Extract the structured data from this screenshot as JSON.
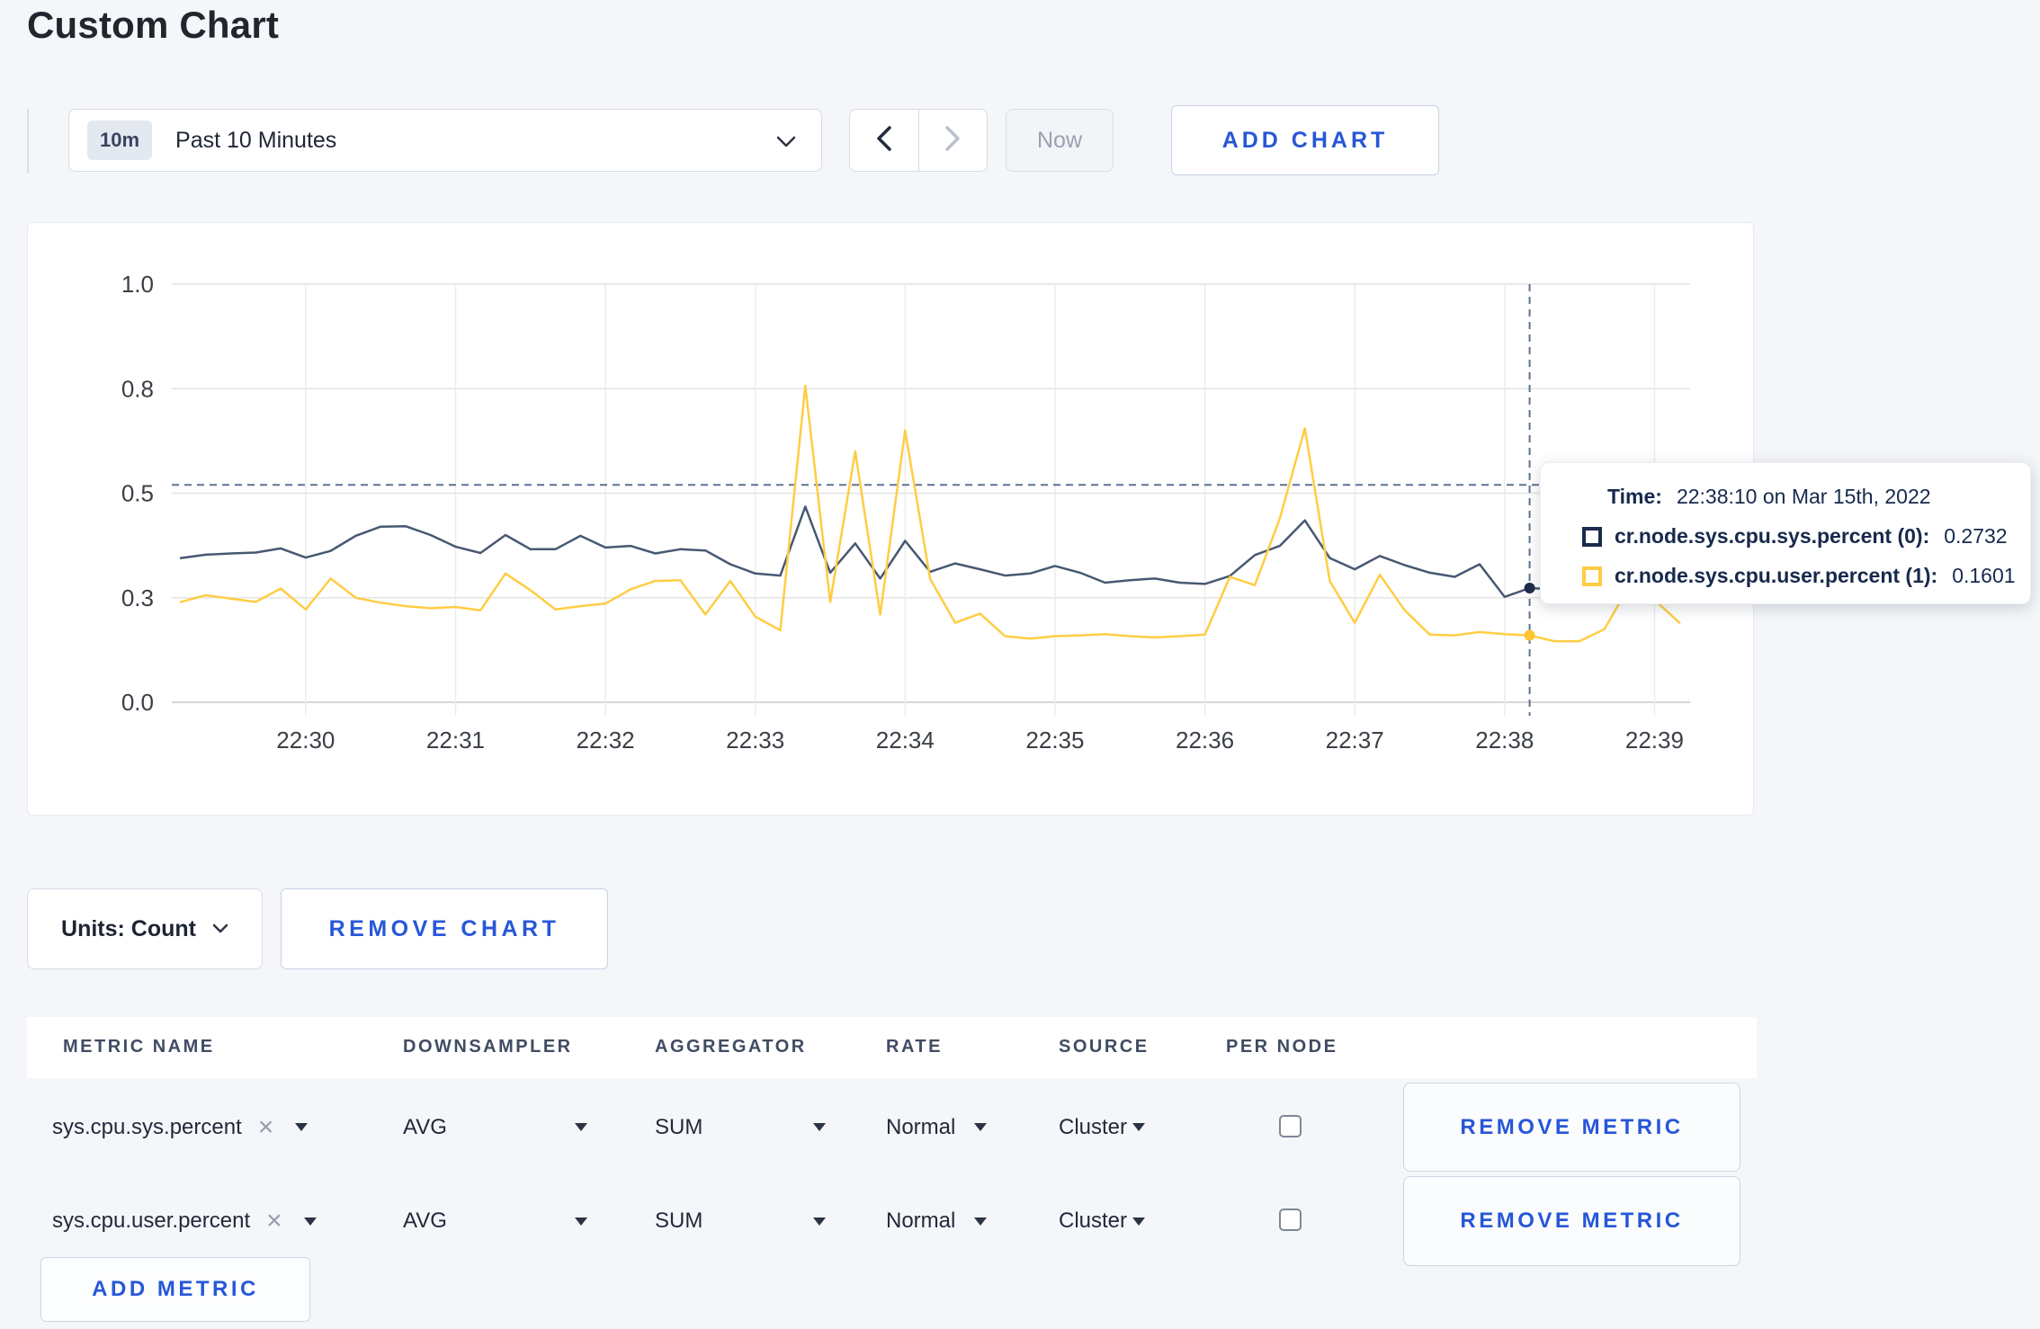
{
  "page": {
    "title": "Custom Chart"
  },
  "toolbar": {
    "time_range": {
      "badge": "10m",
      "label": "Past 10 Minutes"
    },
    "now_label": "Now",
    "add_chart_label": "ADD CHART"
  },
  "chart_data": {
    "type": "line",
    "title": "",
    "xlabel": "",
    "ylabel": "",
    "ylim": [
      0,
      1
    ],
    "grid": true,
    "x_start": "22:29:10",
    "x_step_seconds": 10,
    "x_tick_labels": [
      "22:30",
      "22:31",
      "22:32",
      "22:33",
      "22:34",
      "22:35",
      "22:36",
      "22:37",
      "22:38",
      "22:39"
    ],
    "x_tick_indices": [
      5,
      11,
      17,
      23,
      29,
      35,
      41,
      47,
      53,
      59
    ],
    "y_tick_values": [
      0,
      0.25,
      0.5,
      0.75,
      1.0
    ],
    "y_tick_labels": [
      "0.0",
      "0.3",
      "0.5",
      "0.8",
      "1.0"
    ],
    "series": [
      {
        "name": "cr.node.sys.cpu.sys.percent",
        "color": "#475872",
        "values": [
          0.345,
          0.353,
          0.356,
          0.358,
          0.368,
          0.346,
          0.362,
          0.398,
          0.42,
          0.421,
          0.4,
          0.372,
          0.357,
          0.4,
          0.366,
          0.366,
          0.398,
          0.37,
          0.374,
          0.356,
          0.366,
          0.363,
          0.33,
          0.308,
          0.303,
          0.468,
          0.31,
          0.38,
          0.296,
          0.386,
          0.312,
          0.332,
          0.318,
          0.303,
          0.308,
          0.326,
          0.31,
          0.286,
          0.292,
          0.296,
          0.286,
          0.283,
          0.302,
          0.352,
          0.374,
          0.435,
          0.345,
          0.318,
          0.35,
          0.328,
          0.31,
          0.3,
          0.33,
          0.252,
          0.2732,
          0.27,
          0.285,
          0.272,
          0.266,
          0.272,
          0.28
        ]
      },
      {
        "name": "cr.node.sys.cpu.user.percent",
        "color": "#ffcd44",
        "values": [
          0.24,
          0.256,
          0.248,
          0.24,
          0.272,
          0.222,
          0.296,
          0.25,
          0.238,
          0.23,
          0.225,
          0.228,
          0.22,
          0.308,
          0.268,
          0.222,
          0.23,
          0.236,
          0.27,
          0.29,
          0.292,
          0.21,
          0.29,
          0.205,
          0.172,
          0.757,
          0.24,
          0.6,
          0.21,
          0.65,
          0.295,
          0.19,
          0.212,
          0.158,
          0.152,
          0.158,
          0.16,
          0.163,
          0.158,
          0.155,
          0.158,
          0.162,
          0.3,
          0.28,
          0.44,
          0.655,
          0.29,
          0.19,
          0.305,
          0.22,
          0.162,
          0.16,
          0.168,
          0.163,
          0.1601,
          0.146,
          0.146,
          0.175,
          0.28,
          0.245,
          0.19
        ]
      }
    ],
    "crosshair": {
      "x_index": 54,
      "mouse_y_value": 0.52
    },
    "hover_points": [
      {
        "series": 0,
        "x_index": 54,
        "value": 0.2732
      },
      {
        "series": 1,
        "x_index": 54,
        "value": 0.1601
      }
    ]
  },
  "tooltip": {
    "time_label": "Time:",
    "time_value": "22:38:10 on Mar 15th, 2022",
    "rows": [
      {
        "label": "cr.node.sys.cpu.sys.percent (0):",
        "value": "0.2732",
        "color": "#1c2b4d"
      },
      {
        "label": "cr.node.sys.cpu.user.percent (1):",
        "value": "0.1601",
        "color": "#ffcd44"
      }
    ]
  },
  "chart_footer": {
    "units_label": "Units: Count",
    "remove_chart_label": "REMOVE CHART"
  },
  "table": {
    "headers": [
      "METRIC NAME",
      "DOWNSAMPLER",
      "AGGREGATOR",
      "RATE",
      "SOURCE",
      "PER NODE"
    ],
    "rows": [
      {
        "metric": "sys.cpu.sys.percent",
        "downsampler": "AVG",
        "aggregator": "SUM",
        "rate": "Normal",
        "source": "Cluster",
        "per_node": false,
        "remove_label": "REMOVE METRIC"
      },
      {
        "metric": "sys.cpu.user.percent",
        "downsampler": "AVG",
        "aggregator": "SUM",
        "rate": "Normal",
        "source": "Cluster",
        "per_node": false,
        "remove_label": "REMOVE METRIC"
      }
    ],
    "add_metric_label": "ADD METRIC"
  }
}
